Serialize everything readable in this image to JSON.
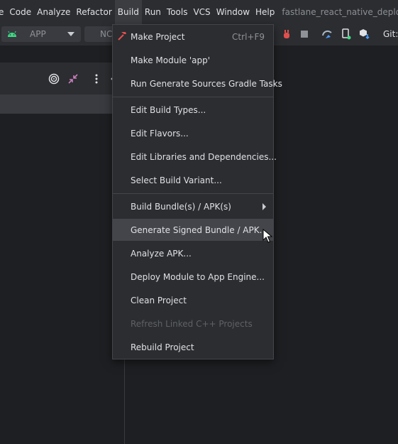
{
  "menubar": {
    "items": [
      "e",
      "Code",
      "Analyze",
      "Refactor",
      "Build",
      "Run",
      "Tools",
      "VCS",
      "Window",
      "Help"
    ],
    "active_index": 4,
    "project_title": "fastlane_react_native_deployn"
  },
  "toolbar": {
    "config_label": "APP",
    "device_label": "NC",
    "git_label": "Git:"
  },
  "build_menu": {
    "items": [
      {
        "label": "Make Project",
        "shortcut": "Ctrl+F9",
        "icon": "hammer-icon",
        "disabled": false,
        "hover": false,
        "submenu": false
      },
      {
        "label": "Make Module 'app'",
        "shortcut": "",
        "disabled": false,
        "hover": false,
        "submenu": false
      },
      {
        "label": "Run Generate Sources Gradle Tasks",
        "shortcut": "",
        "disabled": false,
        "hover": false,
        "submenu": false
      },
      {
        "label": "Edit Build Types...",
        "shortcut": "",
        "disabled": false,
        "hover": false,
        "submenu": false
      },
      {
        "label": "Edit Flavors...",
        "shortcut": "",
        "disabled": false,
        "hover": false,
        "submenu": false
      },
      {
        "label": "Edit Libraries and Dependencies...",
        "shortcut": "",
        "disabled": false,
        "hover": false,
        "submenu": false
      },
      {
        "label": "Select Build Variant...",
        "shortcut": "",
        "disabled": false,
        "hover": false,
        "submenu": false
      },
      {
        "label": "Build Bundle(s) / APK(s)",
        "shortcut": "",
        "disabled": false,
        "hover": false,
        "submenu": true
      },
      {
        "label": "Generate Signed Bundle / APK...",
        "shortcut": "",
        "disabled": false,
        "hover": true,
        "submenu": false
      },
      {
        "label": "Analyze APK...",
        "shortcut": "",
        "disabled": false,
        "hover": false,
        "submenu": false
      },
      {
        "label": "Deploy Module to App Engine...",
        "shortcut": "",
        "disabled": false,
        "hover": false,
        "submenu": false
      },
      {
        "label": "Clean Project",
        "shortcut": "",
        "disabled": false,
        "hover": false,
        "submenu": false
      },
      {
        "label": "Refresh Linked C++ Projects",
        "shortcut": "",
        "disabled": true,
        "hover": false,
        "submenu": false
      },
      {
        "label": "Rebuild Project",
        "shortcut": "",
        "disabled": false,
        "hover": false,
        "submenu": false
      }
    ]
  },
  "colors": {
    "background": "#1e1f22",
    "chrome": "#2b2d30",
    "hover": "#43454a",
    "android_green": "#3ddc84",
    "run_red": "#e0504f",
    "accent_blue": "#4a9eff"
  }
}
